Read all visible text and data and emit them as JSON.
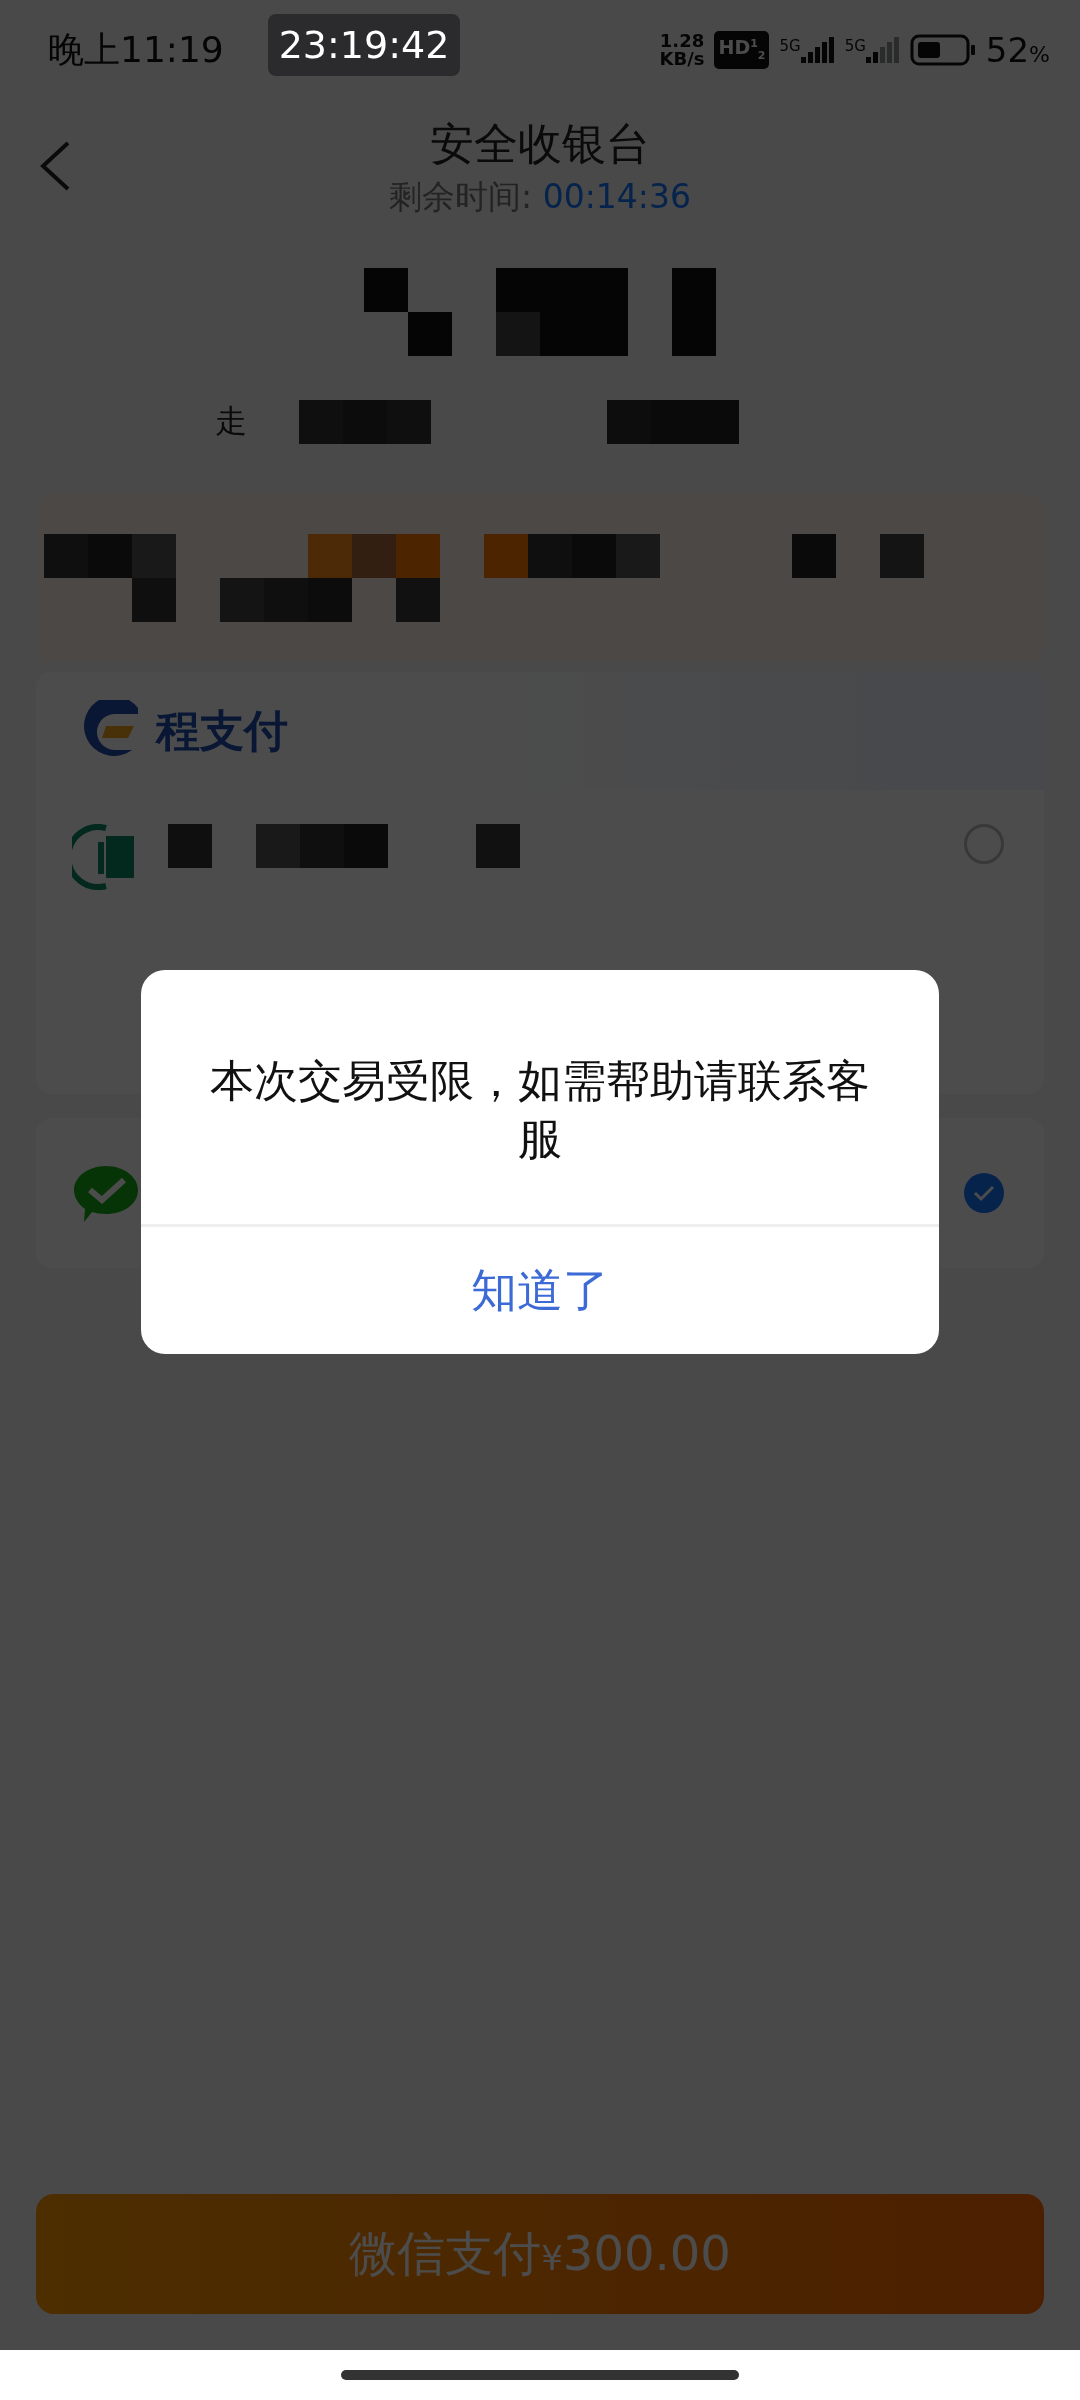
{
  "status_bar": {
    "time": "晚上11:19",
    "speed_value": "1.28",
    "speed_unit": "KB/s",
    "hd_badge": "HD$^{1}$$_{2}$",
    "sim_labels": [
      "5G",
      "5G"
    ],
    "battery_percent": "52",
    "percent_sign": "%"
  },
  "clock_overlay": "23:19:42",
  "header": {
    "title": "安全收银台",
    "countdown_label": "剩余时间: ",
    "countdown": "00:14:36"
  },
  "merchant_fragment": "走",
  "provider": {
    "name": "程支付"
  },
  "methods": [
    {
      "kind": "bank",
      "selected": false
    },
    {
      "kind": "wechat",
      "selected": true
    }
  ],
  "dialog": {
    "message": "本次交易受限，如需帮助请联系客服",
    "button": "知道了"
  },
  "pay_button": {
    "label": "微信支付",
    "currency": "¥",
    "amount": "300.00"
  }
}
